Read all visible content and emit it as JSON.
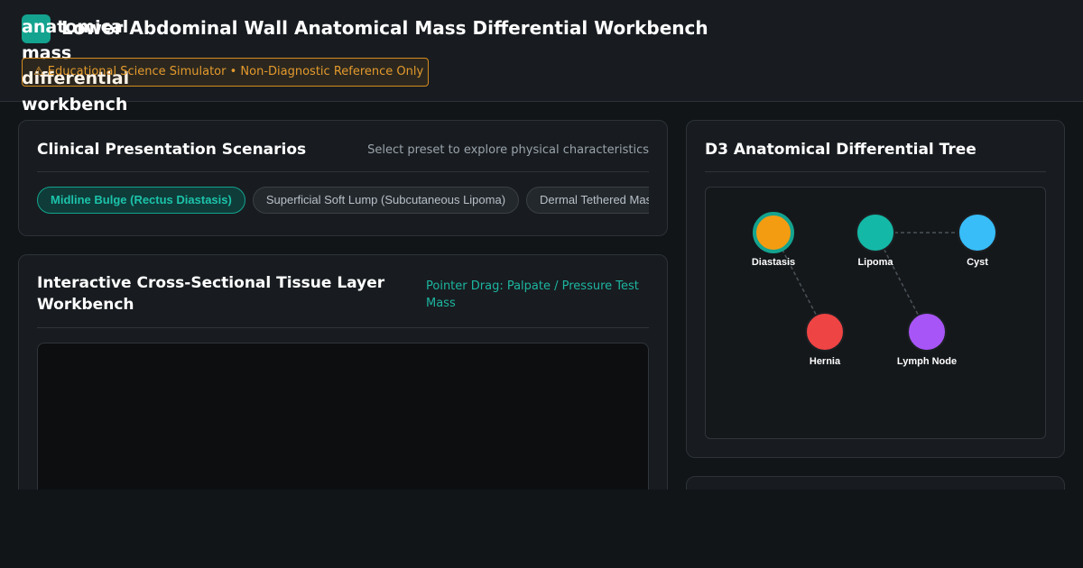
{
  "header": {
    "logo_text": "anatomical mass differential workbench",
    "title": "Lower Abdominal Wall Anatomical Mass Differential Workbench",
    "disclaimer": "⚠ Educational Science Simulator • Non-Diagnostic Reference Only"
  },
  "scenarios": {
    "title": "Clinical Presentation Scenarios",
    "subtitle": "Select preset to explore physical characteristics",
    "presets": [
      {
        "label": "Midline Bulge (Rectus Diastasis)",
        "active": true
      },
      {
        "label": "Superficial Soft Lump (Subcutaneous Lipoma)",
        "active": false
      },
      {
        "label": "Dermal Tethered Mass",
        "active": false
      }
    ]
  },
  "workbench": {
    "title": "Interactive Cross-Sectional Tissue Layer Workbench",
    "hint": "Pointer Drag: Palpate / Pressure Test Mass"
  },
  "tree": {
    "title": "D3 Anatomical Differential Tree",
    "nodes": [
      {
        "id": "diastasis",
        "label": "Diastasis",
        "color": "#f39c12",
        "selected": true
      },
      {
        "id": "lipoma",
        "label": "Lipoma",
        "color": "#14b8a6",
        "selected": false
      },
      {
        "id": "cyst",
        "label": "Cyst",
        "color": "#38bdf8",
        "selected": false
      },
      {
        "id": "hernia",
        "label": "Hernia",
        "color": "#ef4444",
        "selected": false
      },
      {
        "id": "lymph",
        "label": "Lymph Node",
        "color": "#a855f7",
        "selected": false
      }
    ],
    "links": [
      {
        "source": "diastasis",
        "target": "hernia"
      },
      {
        "source": "lipoma",
        "target": "cyst"
      },
      {
        "source": "lipoma",
        "target": "lymph"
      }
    ],
    "selection_ring_color": "#14a38f"
  }
}
